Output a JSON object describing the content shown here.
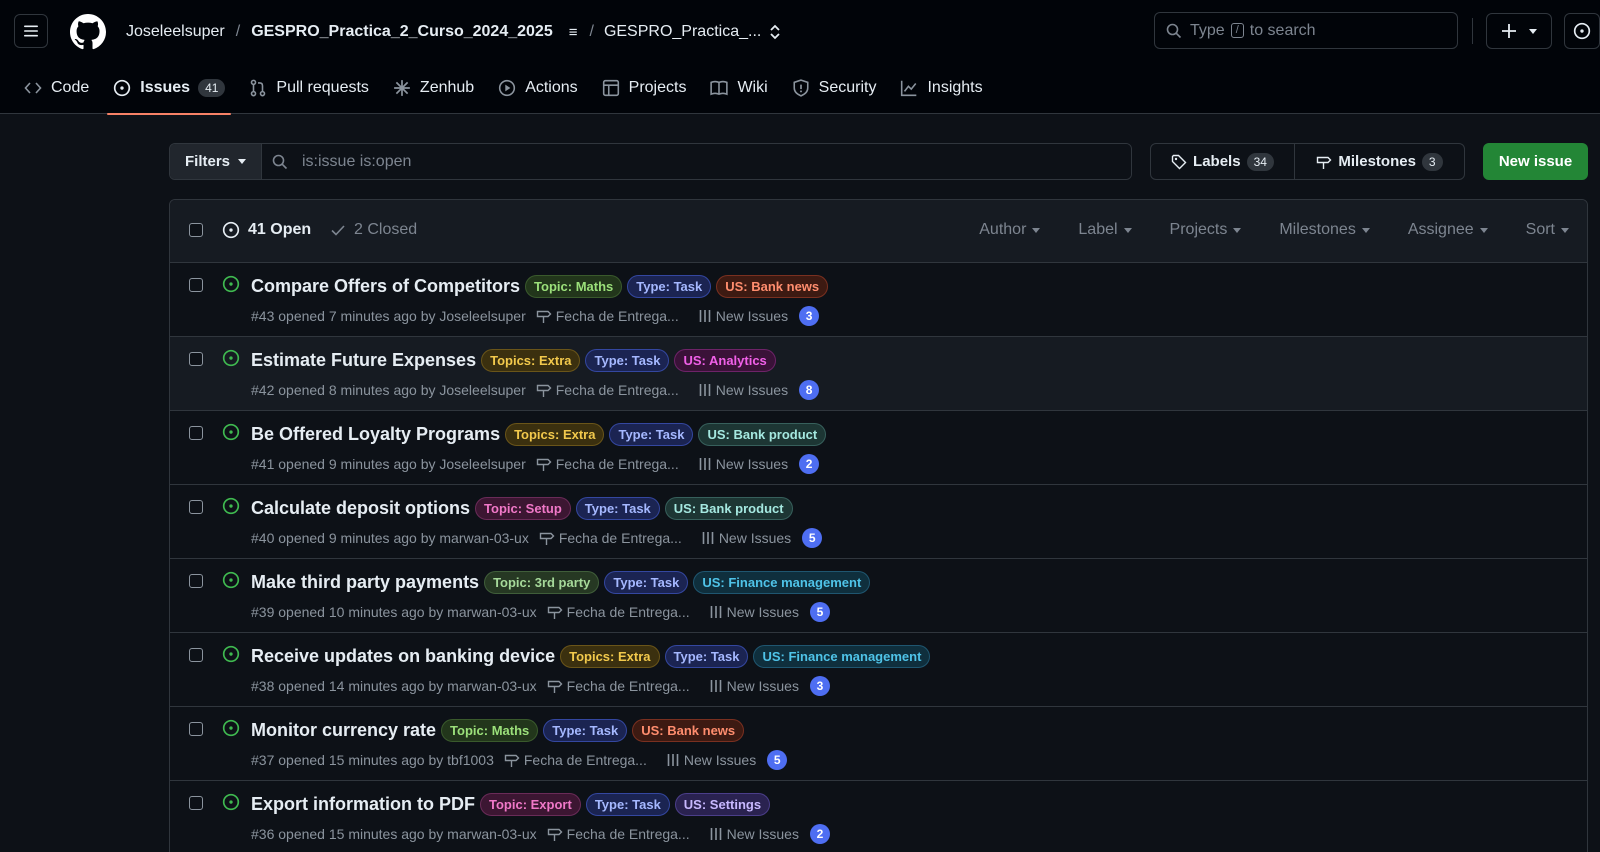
{
  "header": {
    "owner": "Joseleelsuper",
    "repo": "GESPRO_Practica_2_Curso_2024_2025",
    "project": "GESPRO_Practica_...",
    "search_prefix": "Type",
    "search_key": "/",
    "search_suffix": "to search"
  },
  "tabs": [
    {
      "label": "Code",
      "icon": "code-icon"
    },
    {
      "label": "Issues",
      "icon": "issue-opened-icon",
      "count": "41",
      "active": true
    },
    {
      "label": "Pull requests",
      "icon": "git-pull-request-icon"
    },
    {
      "label": "Zenhub",
      "icon": "zenhub-icon"
    },
    {
      "label": "Actions",
      "icon": "play-icon"
    },
    {
      "label": "Projects",
      "icon": "table-icon"
    },
    {
      "label": "Wiki",
      "icon": "book-icon"
    },
    {
      "label": "Security",
      "icon": "shield-icon"
    },
    {
      "label": "Insights",
      "icon": "graph-icon"
    }
  ],
  "toolbar": {
    "filters_label": "Filters",
    "query": "is:issue is:open",
    "labels_label": "Labels",
    "labels_count": "34",
    "milestones_label": "Milestones",
    "milestones_count": "3",
    "new_issue_label": "New issue"
  },
  "list_header": {
    "open_label": "41 Open",
    "closed_label": "2 Closed",
    "menus": [
      "Author",
      "Label",
      "Projects",
      "Milestones",
      "Assignee",
      "Sort"
    ]
  },
  "label_colors": {
    "Topic: Maths": {
      "fg": "#9be07a",
      "bg": "#22361b",
      "border": "#3a5a2c"
    },
    "Topics: Extra": {
      "fg": "#f2c94c",
      "bg": "#3b300f",
      "border": "#6a5519"
    },
    "Topic: Setup": {
      "fg": "#f078c8",
      "bg": "#3c1632",
      "border": "#6a2b58"
    },
    "Topic: 3rd party": {
      "fg": "#a6d99a",
      "bg": "#263823",
      "border": "#405e3a"
    },
    "Topic: Export": {
      "fg": "#f078c8",
      "bg": "#3c1632",
      "border": "#6a2b58"
    },
    "Type: Task": {
      "fg": "#a5b8ff",
      "bg": "#1b2452",
      "border": "#3447a0"
    },
    "US: Bank news": {
      "fg": "#ff8d6e",
      "bg": "#3d1a12",
      "border": "#7a3020"
    },
    "US: Analytics": {
      "fg": "#f060e8",
      "bg": "#3a1238",
      "border": "#6e2368"
    },
    "US: Bank product": {
      "fg": "#a5e8e0",
      "bg": "#1d3634",
      "border": "#37605c"
    },
    "US: Finance management": {
      "fg": "#4fc3e8",
      "bg": "#0f2f3d",
      "border": "#1f5670"
    },
    "US: Settings": {
      "fg": "#c8b8ff",
      "bg": "#2a2250",
      "border": "#4b3e8a"
    }
  },
  "issues": [
    {
      "title": "Compare Offers of Competitors",
      "labels": [
        "Topic: Maths",
        "Type: Task",
        "US: Bank news"
      ],
      "meta": "#43 opened 7 minutes ago by Joseleelsuper",
      "milestone": "Fecha de Entrega...",
      "project": "New Issues",
      "count": "3"
    },
    {
      "title": "Estimate Future Expenses",
      "labels": [
        "Topics: Extra",
        "Type: Task",
        "US: Analytics"
      ],
      "meta": "#42 opened 8 minutes ago by Joseleelsuper",
      "milestone": "Fecha de Entrega...",
      "project": "New Issues",
      "count": "8"
    },
    {
      "title": "Be Offered Loyalty Programs",
      "labels": [
        "Topics: Extra",
        "Type: Task",
        "US: Bank product"
      ],
      "meta": "#41 opened 9 minutes ago by Joseleelsuper",
      "milestone": "Fecha de Entrega...",
      "project": "New Issues",
      "count": "2"
    },
    {
      "title": "Calculate deposit options",
      "labels": [
        "Topic: Setup",
        "Type: Task",
        "US: Bank product"
      ],
      "meta": "#40 opened 9 minutes ago by marwan-03-ux",
      "milestone": "Fecha de Entrega...",
      "project": "New Issues",
      "count": "5"
    },
    {
      "title": "Make third party payments",
      "labels": [
        "Topic: 3rd party",
        "Type: Task",
        "US: Finance management"
      ],
      "meta": "#39 opened 10 minutes ago by marwan-03-ux",
      "milestone": "Fecha de Entrega...",
      "project": "New Issues",
      "count": "5"
    },
    {
      "title": "Receive updates on banking device",
      "labels": [
        "Topics: Extra",
        "Type: Task",
        "US: Finance management"
      ],
      "meta": "#38 opened 14 minutes ago by marwan-03-ux",
      "milestone": "Fecha de Entrega...",
      "project": "New Issues",
      "count": "3"
    },
    {
      "title": "Monitor currency rate",
      "labels": [
        "Topic: Maths",
        "Type: Task",
        "US: Bank news"
      ],
      "meta": "#37 opened 15 minutes ago by tbf1003",
      "milestone": "Fecha de Entrega...",
      "project": "New Issues",
      "count": "5"
    },
    {
      "title": "Export information to PDF",
      "labels": [
        "Topic: Export",
        "Type: Task",
        "US: Settings"
      ],
      "meta": "#36 opened 15 minutes ago by marwan-03-ux",
      "milestone": "Fecha de Entrega...",
      "project": "New Issues",
      "count": "2"
    }
  ]
}
